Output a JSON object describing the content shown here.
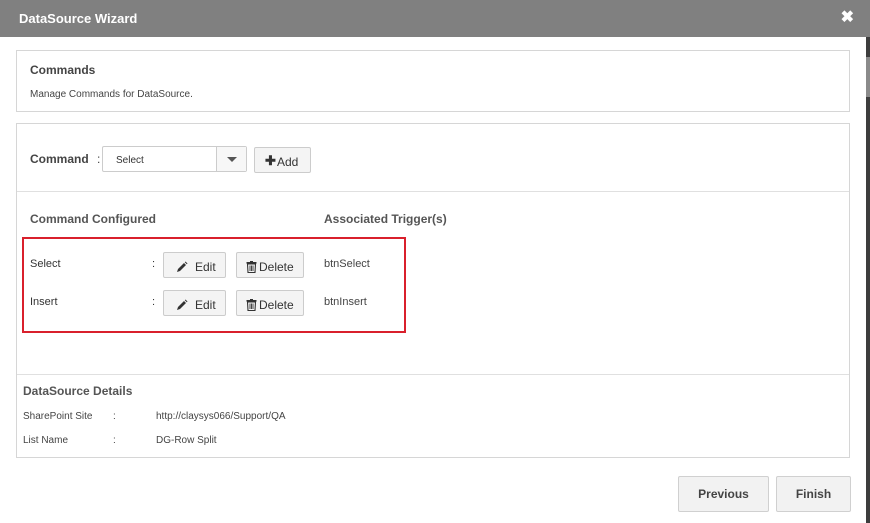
{
  "window": {
    "title": "DataSource Wizard",
    "close_glyph": "✖"
  },
  "commands_section": {
    "heading": "Commands",
    "description": "Manage Commands for DataSource."
  },
  "command_picker": {
    "label": "Command",
    "colon": ":",
    "selected": "Select",
    "add_label": "Add",
    "add_icon": "plus-icon"
  },
  "configured": {
    "col_command": "Command Configured",
    "col_trigger": "Associated Trigger(s)",
    "rows": [
      {
        "name": "Select",
        "colon": ":",
        "edit_label": "Edit",
        "delete_label": "Delete",
        "trigger": "btnSelect"
      },
      {
        "name": "Insert",
        "colon": ":",
        "edit_label": "Edit",
        "delete_label": "Delete",
        "trigger": "btnInsert"
      }
    ],
    "highlight_color": "#d9202c"
  },
  "datasource_details": {
    "heading": "DataSource Details",
    "fields": [
      {
        "label": "SharePoint Site",
        "colon": ":",
        "value": "http://claysys066/Support/QA"
      },
      {
        "label": "List Name",
        "colon": ":",
        "value": "DG-Row Split"
      }
    ]
  },
  "footer": {
    "previous_label": "Previous",
    "finish_label": "Finish"
  },
  "colors": {
    "titlebar": "#808080",
    "border": "#d6d6d6",
    "button_bg": "#f4f4f4"
  }
}
